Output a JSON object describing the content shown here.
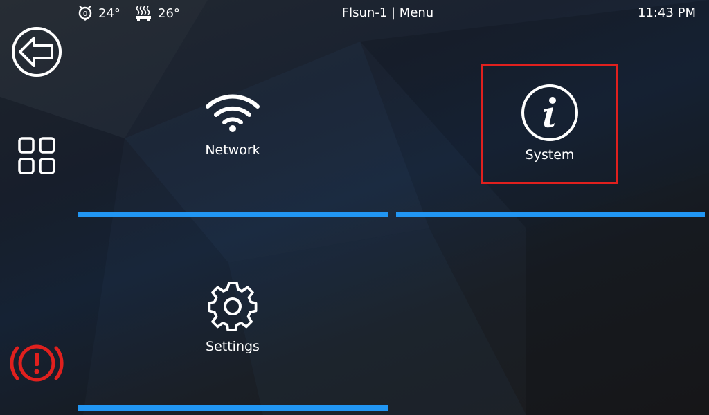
{
  "status": {
    "extruder_icon": "nozzle-temperature-icon",
    "extruder_temp": "24°",
    "bed_icon": "heated-bed-icon",
    "bed_temp": "26°"
  },
  "header": {
    "title": "Flsun-1 | Menu"
  },
  "clock": {
    "time": "11:43 PM"
  },
  "sidebar": {
    "items": [
      {
        "name": "back",
        "icon": "back-arrow-icon"
      },
      {
        "name": "main-menu",
        "icon": "grid-icon"
      },
      {
        "name": "emergency-stop",
        "icon": "emergency-stop-icon",
        "color": "#e0201e"
      }
    ]
  },
  "menu": {
    "tiles": [
      {
        "label": "Network",
        "icon": "wifi-icon"
      },
      {
        "label": "System",
        "icon": "info-icon",
        "highlighted": true
      },
      {
        "label": "Settings",
        "icon": "gear-icon"
      }
    ]
  },
  "colors": {
    "accent": "#2196f3",
    "highlight": "#e0201e",
    "text": "#ffffff"
  }
}
